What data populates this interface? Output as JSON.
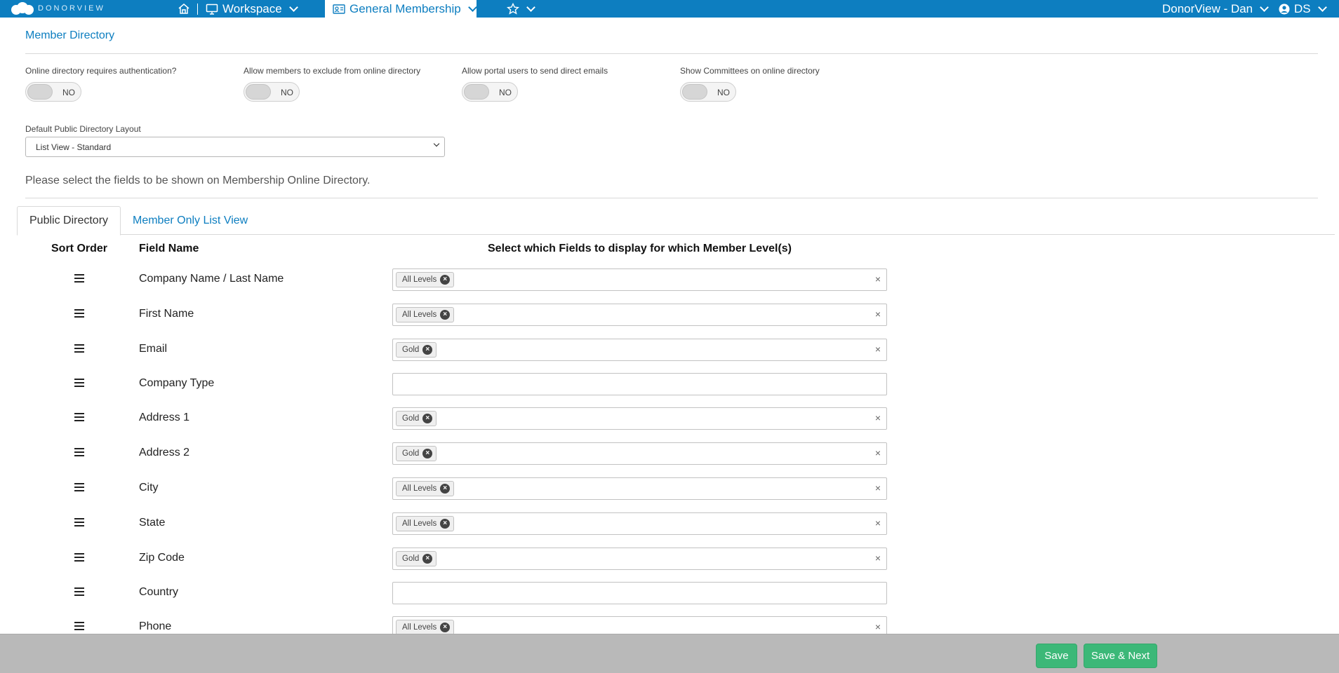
{
  "nav": {
    "logo_text": "DONORVIEW",
    "workspace_label": "Workspace",
    "module_label": "General Membership",
    "account_label": "DonorView - Dan",
    "user_label": "DS"
  },
  "page": {
    "section_title": "Member Directory",
    "toggles": [
      {
        "label": "Online directory requires authentication?",
        "value": "NO"
      },
      {
        "label": "Allow members to exclude from online directory",
        "value": "NO"
      },
      {
        "label": "Allow portal users to send direct emails",
        "value": "NO"
      },
      {
        "label": "Show Committees on online directory",
        "value": "NO"
      }
    ],
    "layout_label": "Default Public Directory Layout",
    "layout_value": "List View - Standard",
    "instructions": "Please select the fields to be shown on Membership Online Directory."
  },
  "tabs": {
    "public": "Public Directory",
    "member_only": "Member Only List View"
  },
  "table": {
    "headers": {
      "sort_order": "Sort Order",
      "field_name": "Field Name",
      "levels": "Select which Fields to display for which Member Level(s)"
    },
    "rows": [
      {
        "field": "Company Name / Last Name",
        "level": "All Levels"
      },
      {
        "field": "First Name",
        "level": "All Levels"
      },
      {
        "field": "Email",
        "level": "Gold"
      },
      {
        "field": "Company Type",
        "level": ""
      },
      {
        "field": "Address 1",
        "level": "Gold"
      },
      {
        "field": "Address 2",
        "level": "Gold"
      },
      {
        "field": "City",
        "level": "All Levels"
      },
      {
        "field": "State",
        "level": "All Levels"
      },
      {
        "field": "Zip Code",
        "level": "Gold"
      },
      {
        "field": "Country",
        "level": ""
      },
      {
        "field": "Phone",
        "level": "All Levels"
      }
    ]
  },
  "footer": {
    "save_label": "Save",
    "save_next_label": "Save & Next"
  },
  "colors": {
    "brand_blue": "#0d7ec0",
    "save_green": "#3cb878"
  }
}
